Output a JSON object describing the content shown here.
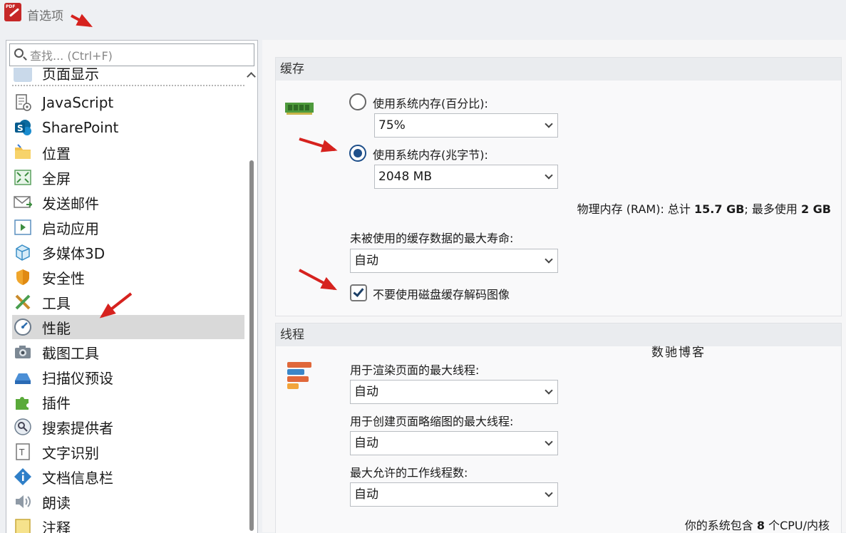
{
  "window": {
    "title": "首选项"
  },
  "search": {
    "placeholder": "查找... (Ctrl+F)"
  },
  "sidebar": {
    "partial_top": "页面显示",
    "items": [
      {
        "label": "JavaScript",
        "icon": "script-gear-icon"
      },
      {
        "label": "SharePoint",
        "icon": "sharepoint-icon"
      },
      {
        "label": "位置",
        "icon": "folder-icon"
      },
      {
        "label": "全屏",
        "icon": "fullscreen-icon"
      },
      {
        "label": "发送邮件",
        "icon": "mail-icon"
      },
      {
        "label": "启动应用",
        "icon": "launch-app-icon"
      },
      {
        "label": "多媒体3D",
        "icon": "3d-cube-icon"
      },
      {
        "label": "安全性",
        "icon": "shield-icon"
      },
      {
        "label": "工具",
        "icon": "tools-icon"
      },
      {
        "label": "性能",
        "icon": "gauge-icon",
        "selected": true
      },
      {
        "label": "截图工具",
        "icon": "camera-icon"
      },
      {
        "label": "扫描仪预设",
        "icon": "scanner-icon"
      },
      {
        "label": "插件",
        "icon": "puzzle-icon"
      },
      {
        "label": "搜索提供者",
        "icon": "search-provider-icon"
      },
      {
        "label": "文字识别",
        "icon": "ocr-icon"
      },
      {
        "label": "文档信息栏",
        "icon": "info-icon"
      },
      {
        "label": "朗读",
        "icon": "speaker-icon"
      },
      {
        "label": "注释",
        "icon": "comment-icon"
      }
    ]
  },
  "cache": {
    "header": "缓存",
    "opt_percent": "使用系统内存(百分比):",
    "percent_value": "75%",
    "opt_mb": "使用系统内存(兆字节):",
    "mb_value": "2048 MB",
    "ram_prefix": "物理内存 (RAM): 总计 ",
    "ram_total": "15.7 GB",
    "ram_mid": "; 最多使用 ",
    "ram_max": "2 GB",
    "lifetime_label": "未被使用的缓存数据的最大寿命:",
    "lifetime_value": "自动",
    "disk_checkbox_label": "不要使用磁盘缓存解码图像",
    "selected_option": "mb",
    "disk_checked": true
  },
  "threads": {
    "header": "线程",
    "render_label": "用于渲染页面的最大线程:",
    "render_value": "自动",
    "thumb_label": "用于创建页面略缩图的最大线程:",
    "thumb_value": "自动",
    "worker_label": "最大允许的工作线程数:",
    "worker_value": "自动",
    "cpu_prefix": "你的系统包含 ",
    "cpu_count": "8",
    "cpu_suffix": " 个CPU/内核"
  },
  "watermark": "数驰博客",
  "colors": {
    "accent": "#1e4f8a",
    "annotation_arrow": "#d6221e",
    "selected_row": "#d9d9d9"
  }
}
